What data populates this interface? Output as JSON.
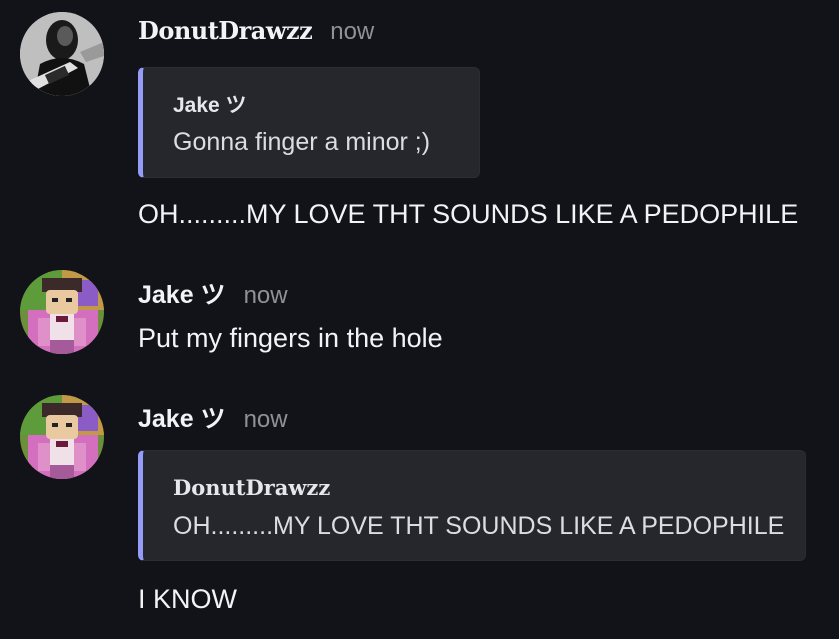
{
  "messages": [
    {
      "username": "DonutDrawzz",
      "timestamp": "now",
      "reply": {
        "author": "Jake ツ",
        "text": "Gonna finger a minor ;)"
      },
      "text": "OH.........MY LOVE THT SOUNDS LIKE A PEDOPHILE",
      "avatar_icon": "guitarist-photo-avatar"
    },
    {
      "username": "Jake ツ",
      "timestamp": "now",
      "text": "Put my fingers in the hole",
      "avatar_icon": "lego-figure-avatar"
    },
    {
      "username": "Jake ツ",
      "timestamp": "now",
      "reply": {
        "author": "DonutDrawzz",
        "text": "OH.........MY LOVE THT SOUNDS LIKE A PEDOPHILE"
      },
      "text": "I KNOW",
      "avatar_icon": "lego-figure-avatar"
    }
  ],
  "colors": {
    "background": "#121219",
    "reply_bar": "#949cf7",
    "reply_background": "#26272d",
    "timestamp": "#8e9297"
  }
}
